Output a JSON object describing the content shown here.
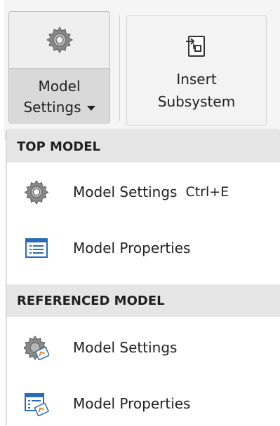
{
  "toolstrip": {
    "model_settings_button": {
      "line1": "Model",
      "line2": "Settings",
      "icon": "gear-icon"
    },
    "insert_subsystem_button": {
      "line1": "Insert",
      "line2": "Subsystem",
      "icon": "subsystem-icon"
    }
  },
  "menu": {
    "sections": [
      {
        "header": "TOP MODEL",
        "items": [
          {
            "label": "Model Settings",
            "shortcut": "Ctrl+E",
            "icon": "gear-icon"
          },
          {
            "label": "Model Properties",
            "icon": "properties-icon"
          }
        ]
      },
      {
        "header": "REFERENCED MODEL",
        "items": [
          {
            "label": "Model Settings",
            "icon": "referenced-gear-icon"
          },
          {
            "label": "Model Properties",
            "icon": "referenced-properties-icon"
          }
        ]
      }
    ]
  },
  "colors": {
    "header_bg": "#e6e6e6",
    "pressed_bg": "#d9d9d9",
    "icon_blue": "#2a6ab8"
  }
}
